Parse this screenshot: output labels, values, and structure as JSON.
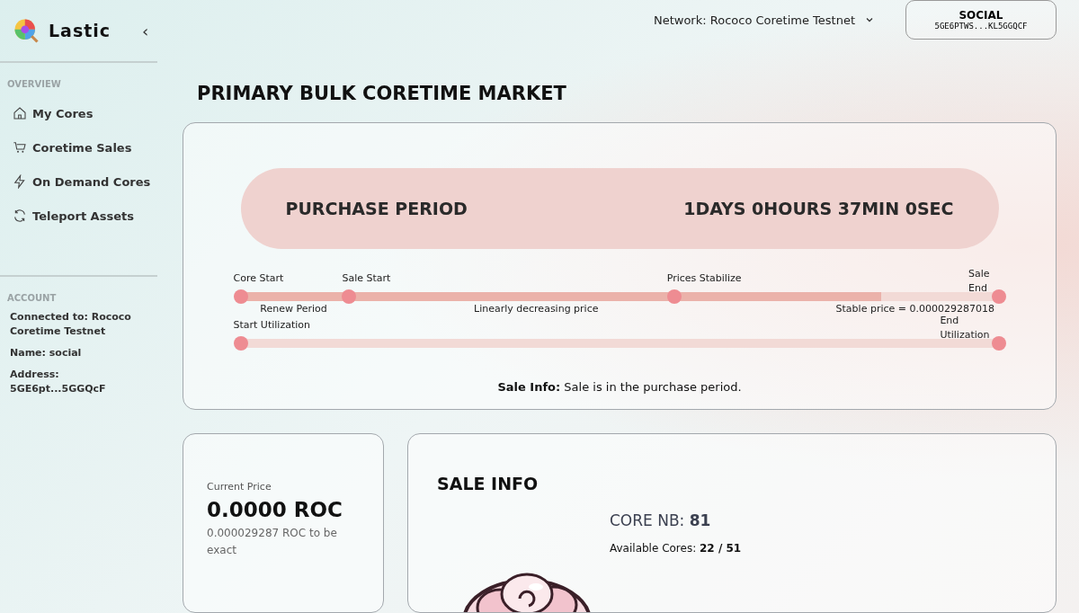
{
  "sidebar": {
    "brand": "Lastic",
    "collapse_icon": "‹",
    "sections": [
      {
        "heading": "OVERVIEW",
        "items": [
          {
            "label": "My Cores",
            "kind": "home"
          },
          {
            "label": "Coretime Sales",
            "kind": "cart"
          },
          {
            "label": "On Demand Cores",
            "kind": "bolt"
          },
          {
            "label": "Teleport Assets",
            "kind": "sync"
          }
        ]
      }
    ],
    "account": {
      "heading": "ACCOUNT",
      "lines": [
        "Connected to: Rococo Coretime Testnet",
        "Name: social",
        "Address: 5GE6pt...5GGQcF"
      ]
    }
  },
  "header": {
    "network": "Network: Rococo Coretime Testnet",
    "account_name": "SOCIAL",
    "account_address": "5GE6PTWS...KL5GGQCF"
  },
  "title": "PRIMARY BULK CORETIME MARKET",
  "period": {
    "label": "PURCHASE PERIOD",
    "countdown": "1DAYS 0HOURS 37MIN 0SEC"
  },
  "sale_timeline": {
    "level": 0.845,
    "top_labels": [
      "Core Start",
      "Sale Start",
      "Prices Stabilize",
      "Sale End"
    ],
    "bottom_labels": [
      "Renew Period",
      "Linearly decreasing price",
      "Stable price = 0.000029287018"
    ]
  },
  "utilization_timeline": {
    "top_labels": [
      "Start Utilization",
      "End Utilization"
    ]
  },
  "sale_info_line": {
    "label": "Sale Info:",
    "text": "Sale is in the purchase period."
  },
  "price_card": {
    "caption": "Current Price",
    "price": "0.0000 ROC",
    "exact": "0.000029287 ROC to be exact"
  },
  "sale_info_card": {
    "title": "SALE INFO",
    "core_label": "CORE NB:",
    "core_value": "81",
    "available_label": "Available Cores:",
    "available_value": "22 / 51"
  }
}
